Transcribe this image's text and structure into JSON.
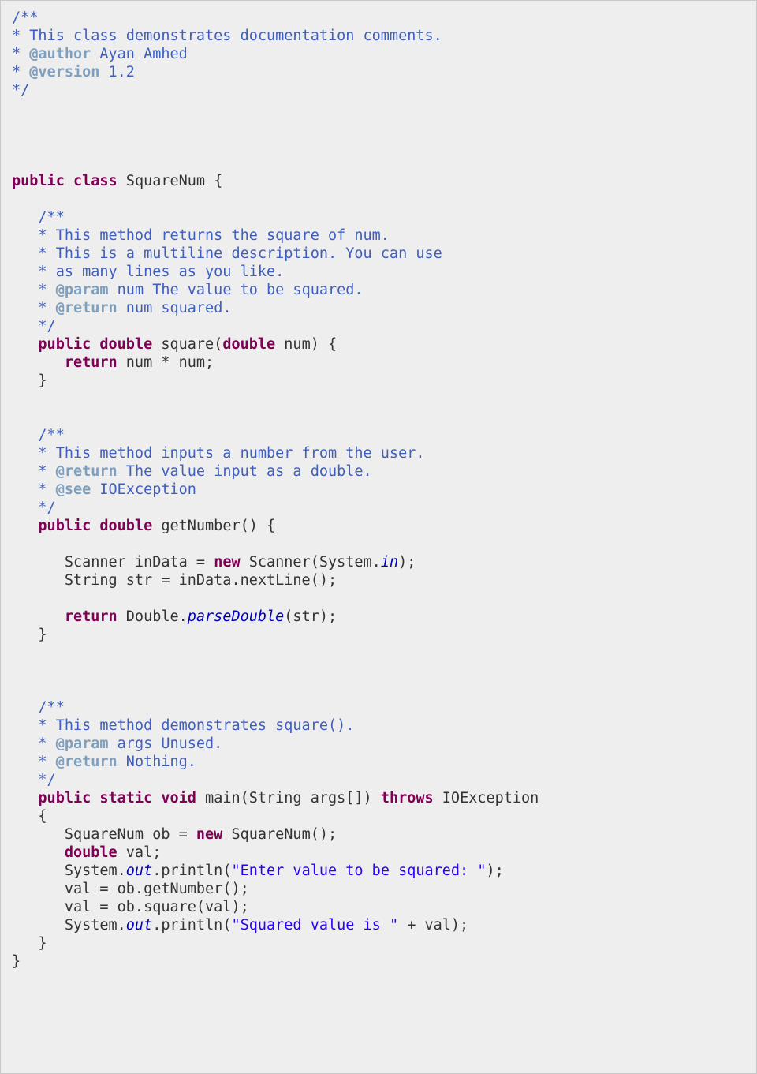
{
  "code": {
    "c1_open": "/**",
    "c1_l1": "* This class demonstrates documentation comments.",
    "c1_l2a": "* ",
    "c1_l2tag": "@author",
    "c1_l2b": " Ayan Amhed",
    "c1_l3a": "* ",
    "c1_l3tag": "@version",
    "c1_l3b": " 1.2",
    "c1_close": "*/",
    "class_l1a": "public",
    "class_l1b": "class",
    "class_l1c": " SquareNum {",
    "c2_open": "   /**",
    "c2_l1": "   * This method returns the square of num.",
    "c2_l2": "   * This is a multiline description. You can use",
    "c2_l3": "   * as many lines as you like.",
    "c2_l4a": "   * ",
    "c2_l4tag": "@param",
    "c2_l4b": " num The value to be squared.",
    "c2_l5a": "   * ",
    "c2_l5tag": "@return",
    "c2_l5b": " num squared.",
    "c2_close": "   */",
    "sq_l1a": "   ",
    "sq_l1kw1": "public",
    "sq_l1s1": " ",
    "sq_l1kw2": "double",
    "sq_l1s2": " square(",
    "sq_l1kw3": "double",
    "sq_l1s3": " num) {",
    "sq_l2a": "      ",
    "sq_l2kw": "return",
    "sq_l2b": " num * num;",
    "sq_l3": "   }",
    "c3_open": "   /**",
    "c3_l1": "   * This method inputs a number from the user.",
    "c3_l2a": "   * ",
    "c3_l2tag": "@return",
    "c3_l2b": " The value input as a double.",
    "c3_l3a": "   * ",
    "c3_l3tag": "@see",
    "c3_l3b": " IOException",
    "c3_close": "   */",
    "gn_l1a": "   ",
    "gn_l1kw1": "public",
    "gn_l1s1": " ",
    "gn_l1kw2": "double",
    "gn_l1s2": " getNumber() {",
    "gn_l2a": "      Scanner inData = ",
    "gn_l2kw": "new",
    "gn_l2b": " Scanner(System.",
    "gn_l2it": "in",
    "gn_l2c": ");",
    "gn_l3": "      String str = inData.nextLine();",
    "gn_l4a": "      ",
    "gn_l4kw": "return",
    "gn_l4b": " Double.",
    "gn_l4it": "parseDouble",
    "gn_l4c": "(str);",
    "gn_l5": "   }",
    "c4_open": "   /**",
    "c4_l1": "   * This method demonstrates square().",
    "c4_l2a": "   * ",
    "c4_l2tag": "@param",
    "c4_l2b": " args Unused.",
    "c4_l3a": "   * ",
    "c4_l3tag": "@return",
    "c4_l3b": " Nothing.",
    "c4_close": "   */",
    "mn_l1a": "   ",
    "mn_l1kw1": "public",
    "mn_l1s1": " ",
    "mn_l1kw2": "static",
    "mn_l1s2": " ",
    "mn_l1kw3": "void",
    "mn_l1s3": " main(String args[]) ",
    "mn_l1kw4": "throws",
    "mn_l1s4": " IOException",
    "mn_l2": "   {",
    "mn_l3a": "      SquareNum ob = ",
    "mn_l3kw": "new",
    "mn_l3b": " SquareNum();",
    "mn_l4a": "      ",
    "mn_l4kw": "double",
    "mn_l4b": " val;",
    "mn_l5a": "      System.",
    "mn_l5it": "out",
    "mn_l5b": ".println(",
    "mn_l5str": "\"Enter value to be squared: \"",
    "mn_l5c": ");",
    "mn_l6": "      val = ob.getNumber();",
    "mn_l7": "      val = ob.square(val);",
    "mn_l8a": "      System.",
    "mn_l8it": "out",
    "mn_l8b": ".println(",
    "mn_l8str": "\"Squared value is \"",
    "mn_l8c": " + val);",
    "mn_l9": "   }",
    "class_end": "}"
  }
}
